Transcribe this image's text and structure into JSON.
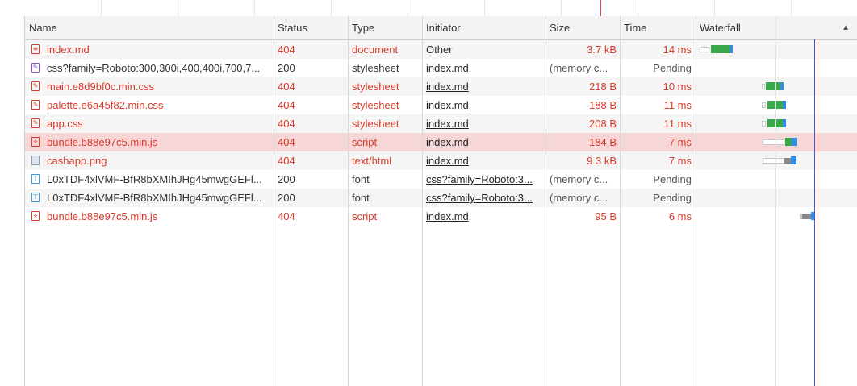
{
  "columns": {
    "name": "Name",
    "status": "Status",
    "type": "Type",
    "initiator": "Initiator",
    "size": "Size",
    "time": "Time",
    "waterfall": "Waterfall",
    "sort_indicator": "▲"
  },
  "colors": {
    "error": "#d93a2b",
    "selected_row": "#f6d6d6",
    "waterfall_green": "#3aa84a",
    "waterfall_blue": "#2f8de4",
    "dom_content_line": "#3b5bdb",
    "load_line": "#d24b4b"
  },
  "rows": [
    {
      "name": "index.md",
      "status": "404",
      "type": "document",
      "initiator": "Other",
      "initiator_link": false,
      "size": "3.7 kB",
      "time": "14 ms",
      "error": true,
      "icon": "document-icon"
    },
    {
      "name": "css?family=Roboto:300,300i,400,400i,700,7...",
      "status": "200",
      "type": "stylesheet",
      "initiator": "index.md",
      "initiator_link": true,
      "size": "(memory c...",
      "time": "Pending",
      "error": false,
      "icon": "stylesheet-icon"
    },
    {
      "name": "main.e8d9bf0c.min.css",
      "status": "404",
      "type": "stylesheet",
      "initiator": "index.md",
      "initiator_link": true,
      "size": "218 B",
      "time": "10 ms",
      "error": true,
      "icon": "stylesheet-icon"
    },
    {
      "name": "palette.e6a45f82.min.css",
      "status": "404",
      "type": "stylesheet",
      "initiator": "index.md",
      "initiator_link": true,
      "size": "188 B",
      "time": "11 ms",
      "error": true,
      "icon": "stylesheet-icon"
    },
    {
      "name": "app.css",
      "status": "404",
      "type": "stylesheet",
      "initiator": "index.md",
      "initiator_link": true,
      "size": "208 B",
      "time": "11 ms",
      "error": true,
      "icon": "stylesheet-icon"
    },
    {
      "name": "bundle.b88e97c5.min.js",
      "status": "404",
      "type": "script",
      "initiator": "index.md",
      "initiator_link": true,
      "size": "184 B",
      "time": "7 ms",
      "error": true,
      "selected": true,
      "icon": "script-icon"
    },
    {
      "name": "cashapp.png",
      "status": "404",
      "type": "text/html",
      "initiator": "index.md",
      "initiator_link": true,
      "size": "9.3 kB",
      "time": "7 ms",
      "error": true,
      "icon": "image-icon"
    },
    {
      "name": "L0xTDF4xlVMF-BfR8bXMIhJHg45mwgGEFl...",
      "status": "200",
      "type": "font",
      "initiator": "css?family=Roboto:3...",
      "initiator_link": true,
      "size": "(memory c...",
      "time": "Pending",
      "error": false,
      "icon": "font-icon"
    },
    {
      "name": "L0xTDF4xlVMF-BfR8bXMIhJHg45mwgGEFl...",
      "status": "200",
      "type": "font",
      "initiator": "css?family=Roboto:3...",
      "initiator_link": true,
      "size": "(memory c...",
      "time": "Pending",
      "error": false,
      "icon": "font-icon"
    },
    {
      "name": "bundle.b88e97c5.min.js",
      "status": "404",
      "type": "script",
      "initiator": "index.md",
      "initiator_link": true,
      "size": "95 B",
      "time": "6 ms",
      "error": true,
      "icon": "script-icon"
    }
  ]
}
